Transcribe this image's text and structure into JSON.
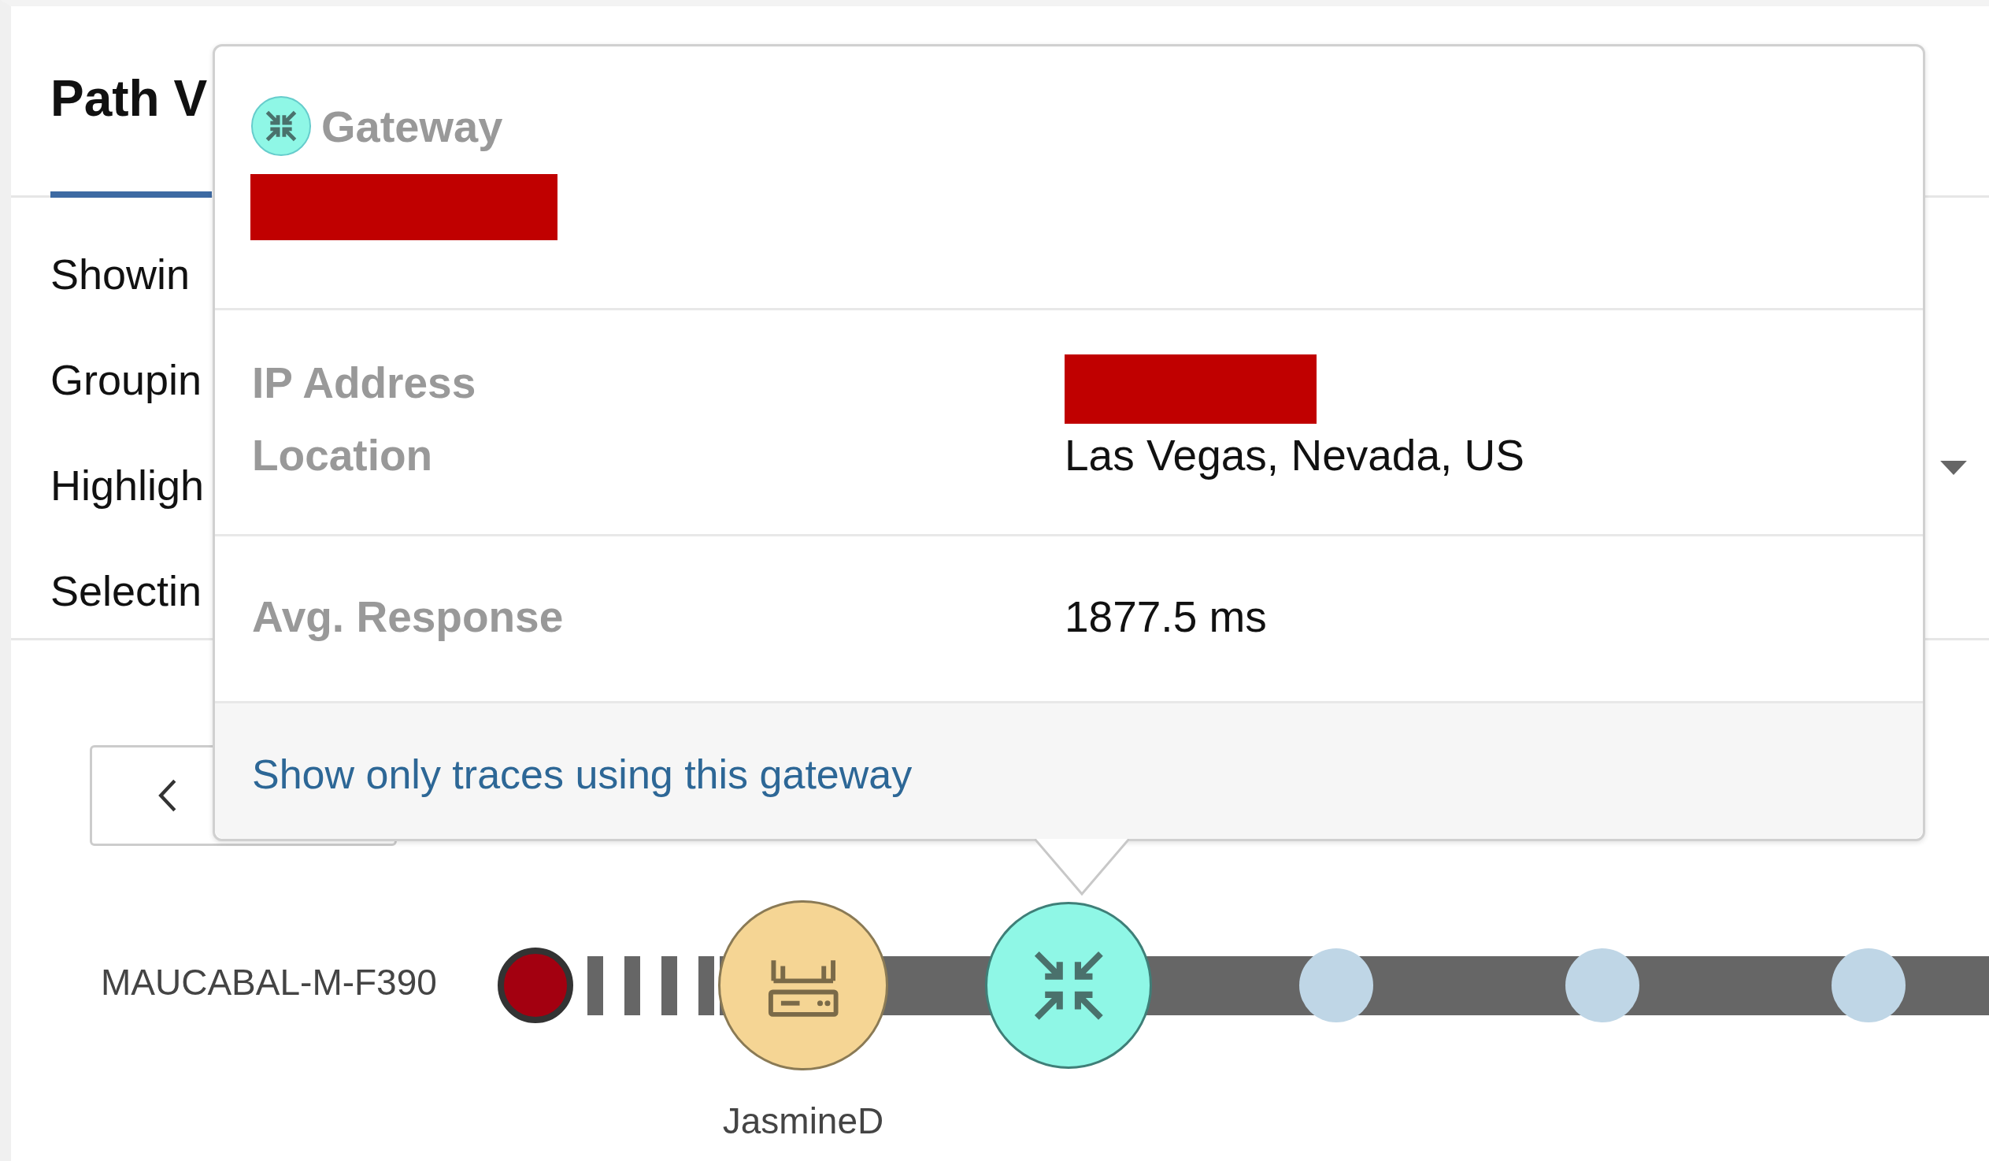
{
  "tabs": [
    {
      "label": "Path V",
      "selected": true
    }
  ],
  "filter_rows": [
    {
      "label": "Showin"
    },
    {
      "label": "Groupin"
    },
    {
      "label": "Highligh"
    },
    {
      "label": "Selectin"
    }
  ],
  "popover": {
    "title": "Gateway",
    "sections": [
      [
        {
          "label": "IP Address",
          "kind": "redacted"
        },
        {
          "label": "Location",
          "kind": "text",
          "value": "Las Vegas, Nevada, US"
        }
      ],
      [
        {
          "label": "Avg. Response",
          "kind": "text",
          "value": "1877.5 ms"
        }
      ]
    ],
    "link": "Show only traces using this gateway"
  },
  "path": {
    "source": "MAUCABAL-M-F390",
    "nodes": [
      {
        "kind": "endpoint",
        "color": "#a30010"
      },
      {
        "kind": "router",
        "color": "#f5d594",
        "label": "JasmineD"
      },
      {
        "kind": "gateway",
        "color": "#8ff7e6"
      },
      {
        "kind": "hop",
        "color": "#bfd6e6"
      },
      {
        "kind": "hop",
        "color": "#bfd6e6"
      },
      {
        "kind": "hop",
        "color": "#bfd6e6"
      }
    ]
  }
}
